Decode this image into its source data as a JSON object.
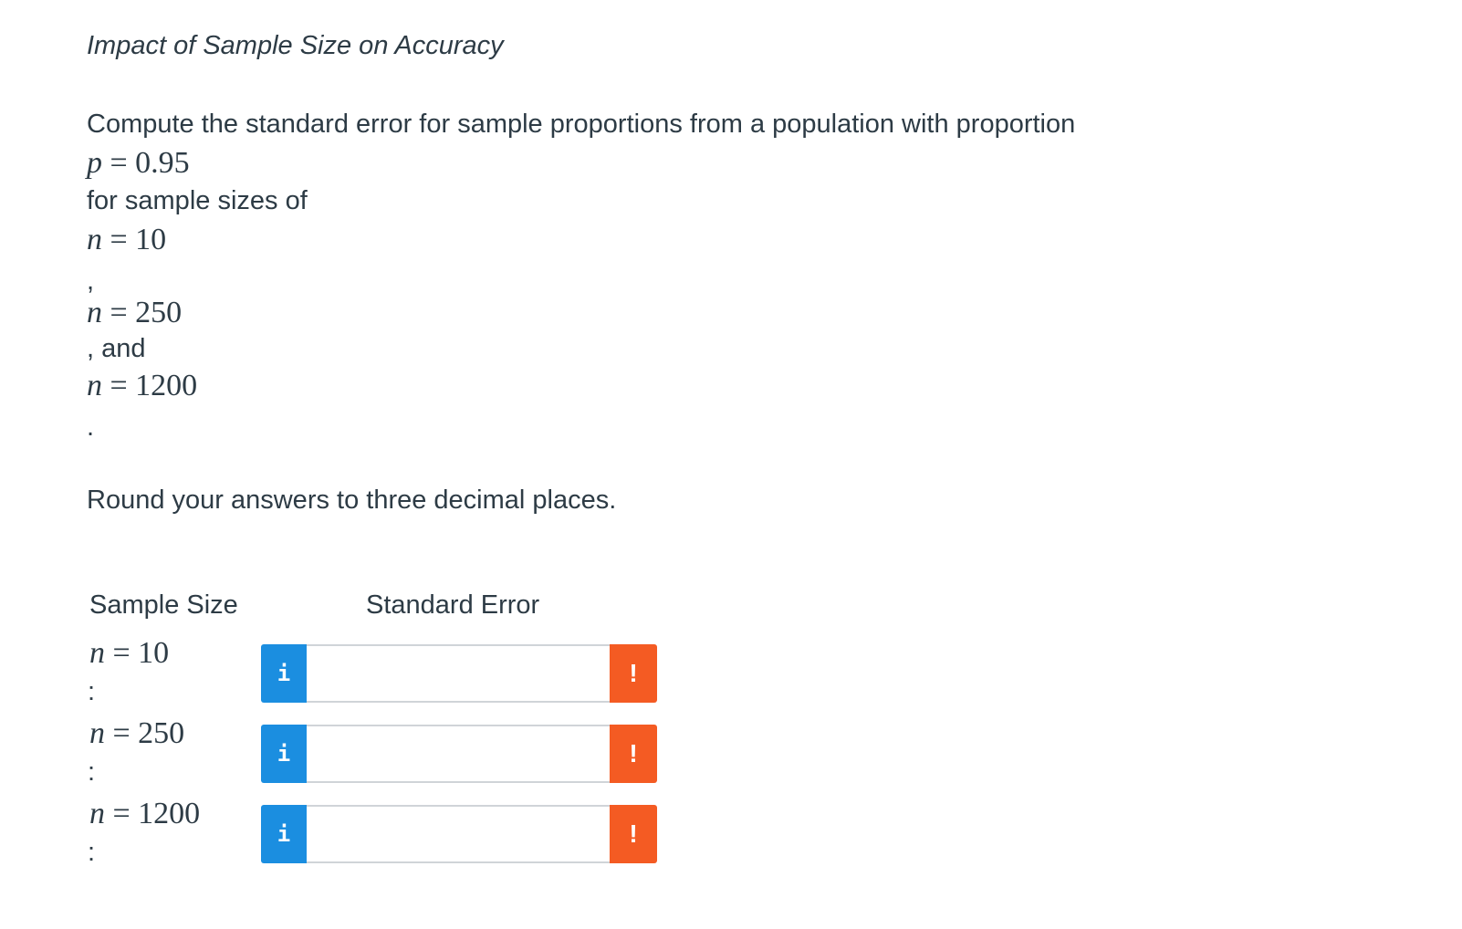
{
  "title": "Impact of Sample Size on Accuracy",
  "question": {
    "intro": "Compute the standard error for sample proportions from a population with proportion",
    "p_var": "p",
    "p_rest": " = 0.95",
    "sizes_intro": "for sample sizes of",
    "n1_var": "n",
    "n1_rest": " = 10",
    "comma1": ",",
    "n2_var": "n",
    "n2_rest": " = 250",
    "and_text": ", and",
    "n3_var": "n",
    "n3_rest": " = 1200",
    "period": ".",
    "instruction": "Round your answers to three decimal places."
  },
  "table": {
    "col_sample_size": "Sample Size",
    "col_standard_error": "Standard Error",
    "rows": [
      {
        "n_var": "n",
        "n_rest": " = 10",
        "colon": ":",
        "info_label": "i",
        "value": "",
        "warn_label": "!"
      },
      {
        "n_var": "n",
        "n_rest": " = 250",
        "colon": ":",
        "info_label": "i",
        "value": "",
        "warn_label": "!"
      },
      {
        "n_var": "n",
        "n_rest": " = 1200",
        "colon": ":",
        "info_label": "i",
        "value": "",
        "warn_label": "!"
      }
    ]
  },
  "colors": {
    "info_button": "#1b8ee0",
    "warning_button": "#f45b23",
    "text": "#2d3b45"
  },
  "icons": {
    "info": "info-icon",
    "warning": "exclamation-icon"
  }
}
